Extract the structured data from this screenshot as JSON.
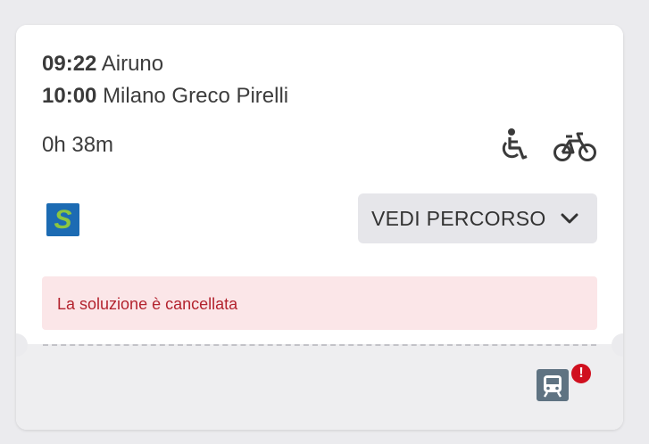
{
  "solution": {
    "departure": {
      "time": "09:22",
      "station": "Airuno"
    },
    "arrival": {
      "time": "10:00",
      "station": "Milano Greco Pirelli"
    },
    "duration": "0h 38m",
    "amenities": [
      "wheelchair-icon",
      "bicycle-icon"
    ],
    "train_category": {
      "label": "S",
      "bg_color": "#1c6bb3",
      "fg_color": "#8cc63f"
    },
    "route_button_label": "VEDI PERCORSO",
    "alert_message": "La soluzione è cancellata",
    "status_badge": "!"
  },
  "colors": {
    "alert_bg": "#fbe6e8",
    "alert_text": "#b3232e",
    "badge_red": "#d0101f",
    "train_icon": "#5f7382"
  }
}
